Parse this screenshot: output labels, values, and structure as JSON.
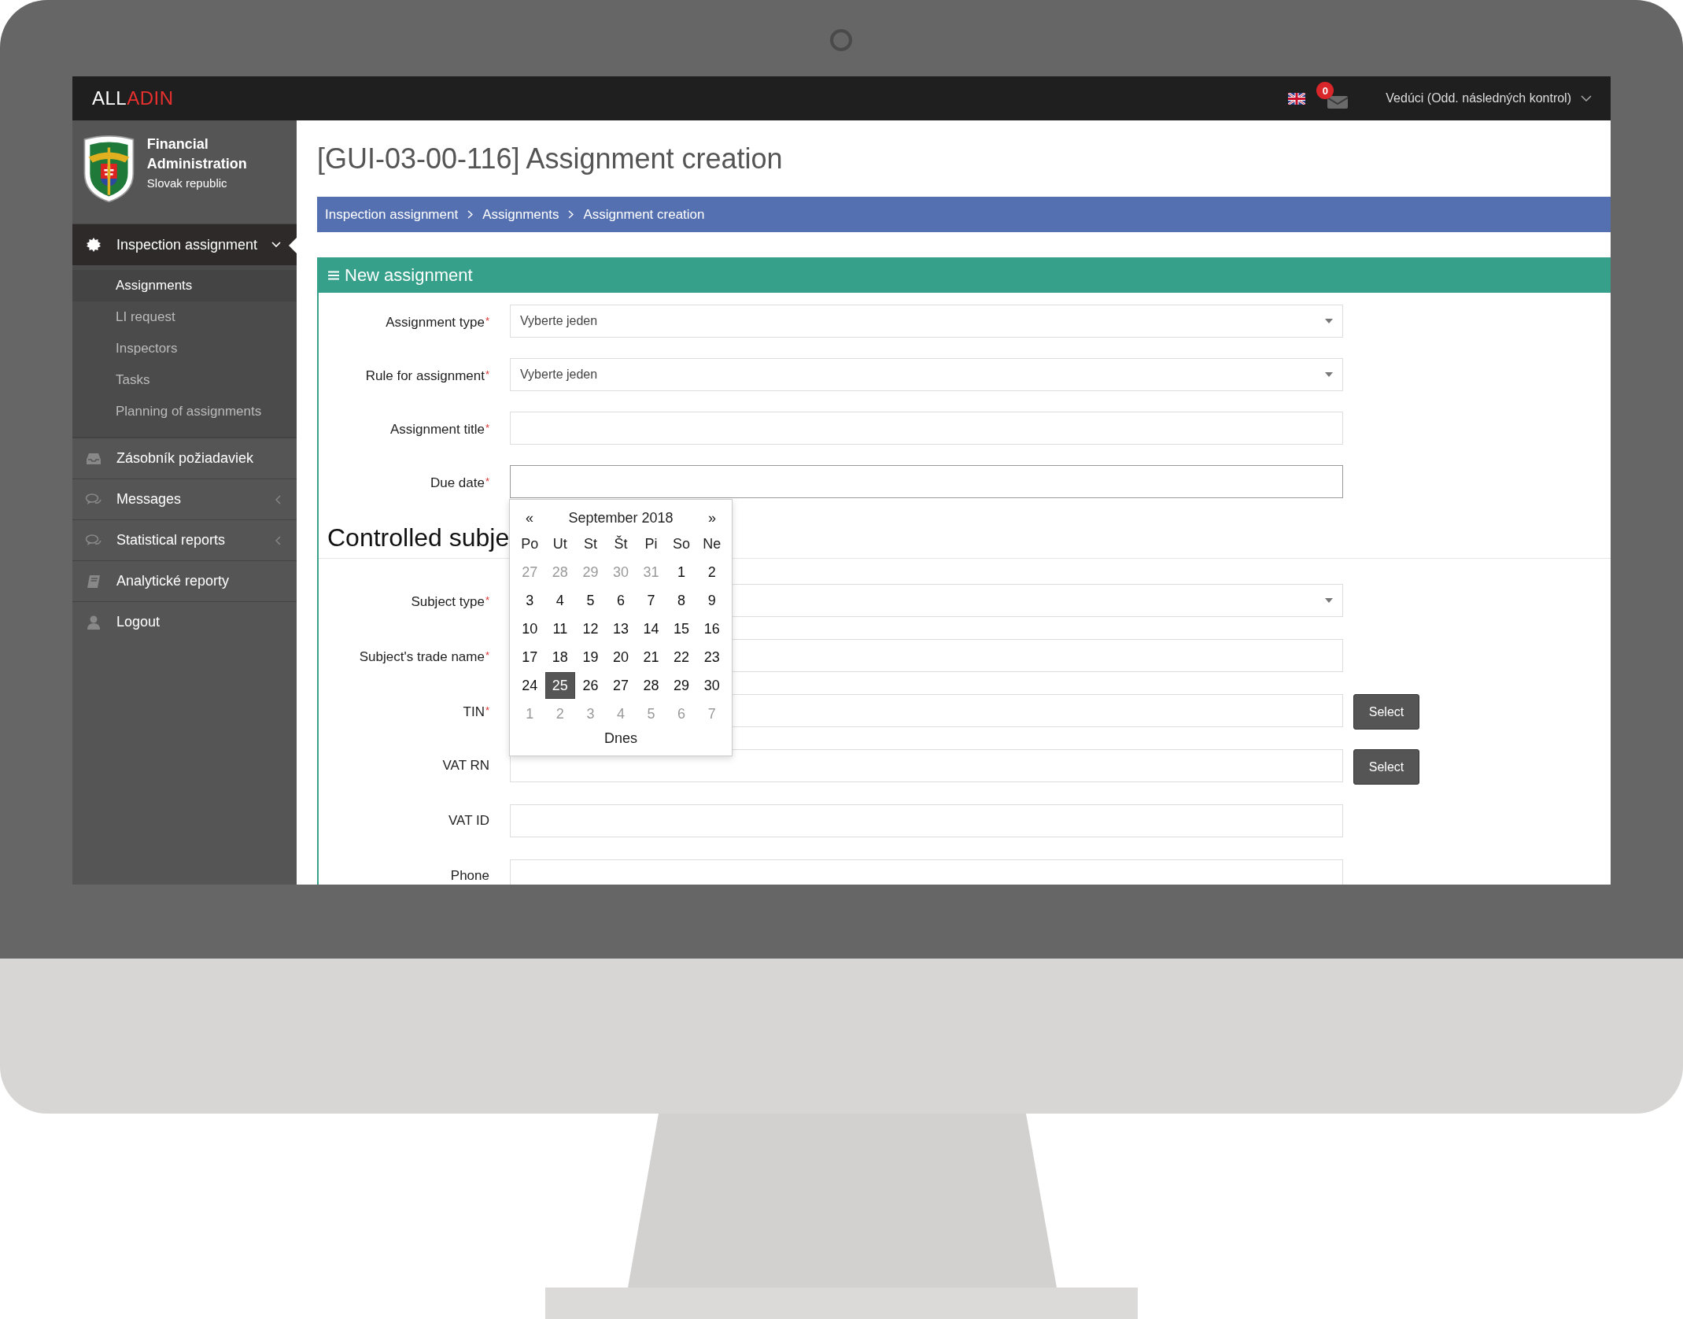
{
  "topbar": {
    "logo": {
      "text": "ALL",
      "accent": "ADIN"
    },
    "mail_badge": "0",
    "user": "Vedúci (Odd. následných kontrol)"
  },
  "sidebar": {
    "org": {
      "name": "Financial Administration",
      "country": "Slovak republic"
    },
    "items": [
      {
        "label": "Inspection assignment",
        "kind": "gear",
        "selected": true,
        "expanded": true,
        "children": [
          {
            "label": "Assignments",
            "selected": true
          },
          {
            "label": "LI request",
            "selected": false
          },
          {
            "label": "Inspectors",
            "selected": false
          },
          {
            "label": "Tasks",
            "selected": false
          },
          {
            "label": "Planning of assignments",
            "selected": false
          }
        ]
      },
      {
        "label": "Zásobník požiadaviek",
        "kind": "inbox",
        "selected": false
      },
      {
        "label": "Messages",
        "kind": "chat",
        "selected": false,
        "expanded": false
      },
      {
        "label": "Statistical reports",
        "kind": "chat",
        "selected": false,
        "expanded": false
      },
      {
        "label": "Analytické reporty",
        "kind": "book",
        "selected": false
      },
      {
        "label": "Logout",
        "kind": "user",
        "selected": false
      }
    ]
  },
  "page": {
    "title": "[GUI-03-00-116] Assignment creation",
    "breadcrumb": [
      "Inspection assignment",
      "Assignments",
      "Assignment creation"
    ]
  },
  "panel": {
    "title": "New assignment",
    "fields": [
      {
        "label": "Assignment type",
        "kind": "select",
        "required_mark": "*",
        "value": "Vyberte jeden"
      },
      {
        "label": "Rule for assignment",
        "kind": "select",
        "required_mark": "*",
        "value": "Vyberte jeden"
      },
      {
        "label": "Assignment title",
        "kind": "text",
        "required_mark": "*"
      },
      {
        "label": "Due date",
        "kind": "date",
        "required_mark": "*"
      }
    ],
    "section_title": "Controlled subje",
    "subject_fields": [
      {
        "label": "Subject type",
        "kind": "select",
        "required_mark": "*"
      },
      {
        "label": "Subject's trade name",
        "kind": "text",
        "required_mark": "*"
      },
      {
        "label": "TIN",
        "kind": "text",
        "required_mark": "*",
        "button": "Select"
      },
      {
        "label": "VAT RN",
        "kind": "text",
        "button": "Select"
      },
      {
        "label": "VAT ID",
        "kind": "text"
      },
      {
        "label": "Phone",
        "kind": "text"
      }
    ]
  },
  "calendar": {
    "prev": "«",
    "month": "September 2018",
    "next": "»",
    "weekdays": [
      "Po",
      "Ut",
      "St",
      "Št",
      "Pi",
      "So",
      "Ne"
    ],
    "weeks": [
      [
        {
          "day": "27",
          "muted": true,
          "selected": false
        },
        {
          "day": "28",
          "muted": true,
          "selected": false
        },
        {
          "day": "29",
          "muted": true,
          "selected": false
        },
        {
          "day": "30",
          "muted": true,
          "selected": false
        },
        {
          "day": "31",
          "muted": true,
          "selected": false
        },
        {
          "day": "1",
          "muted": false,
          "selected": false
        },
        {
          "day": "2",
          "muted": false,
          "selected": false
        }
      ],
      [
        {
          "day": "3",
          "muted": false,
          "selected": false
        },
        {
          "day": "4",
          "muted": false,
          "selected": false
        },
        {
          "day": "5",
          "muted": false,
          "selected": false
        },
        {
          "day": "6",
          "muted": false,
          "selected": false
        },
        {
          "day": "7",
          "muted": false,
          "selected": false
        },
        {
          "day": "8",
          "muted": false,
          "selected": false
        },
        {
          "day": "9",
          "muted": false,
          "selected": false
        }
      ],
      [
        {
          "day": "10",
          "muted": false,
          "selected": false
        },
        {
          "day": "11",
          "muted": false,
          "selected": false
        },
        {
          "day": "12",
          "muted": false,
          "selected": false
        },
        {
          "day": "13",
          "muted": false,
          "selected": false
        },
        {
          "day": "14",
          "muted": false,
          "selected": false
        },
        {
          "day": "15",
          "muted": false,
          "selected": false
        },
        {
          "day": "16",
          "muted": false,
          "selected": false
        }
      ],
      [
        {
          "day": "17",
          "muted": false,
          "selected": false
        },
        {
          "day": "18",
          "muted": false,
          "selected": false
        },
        {
          "day": "19",
          "muted": false,
          "selected": false
        },
        {
          "day": "20",
          "muted": false,
          "selected": false
        },
        {
          "day": "21",
          "muted": false,
          "selected": false
        },
        {
          "day": "22",
          "muted": false,
          "selected": false
        },
        {
          "day": "23",
          "muted": false,
          "selected": false
        }
      ],
      [
        {
          "day": "24",
          "muted": false,
          "selected": false
        },
        {
          "day": "25",
          "muted": false,
          "selected": true
        },
        {
          "day": "26",
          "muted": false,
          "selected": false
        },
        {
          "day": "27",
          "muted": false,
          "selected": false
        },
        {
          "day": "28",
          "muted": false,
          "selected": false
        },
        {
          "day": "29",
          "muted": false,
          "selected": false
        },
        {
          "day": "30",
          "muted": false,
          "selected": false
        }
      ],
      [
        {
          "day": "1",
          "muted": true,
          "selected": false
        },
        {
          "day": "2",
          "muted": true,
          "selected": false
        },
        {
          "day": "3",
          "muted": true,
          "selected": false
        },
        {
          "day": "4",
          "muted": true,
          "selected": false
        },
        {
          "day": "5",
          "muted": true,
          "selected": false
        },
        {
          "day": "6",
          "muted": true,
          "selected": false
        },
        {
          "day": "7",
          "muted": true,
          "selected": false
        }
      ]
    ],
    "today": "Dnes"
  }
}
